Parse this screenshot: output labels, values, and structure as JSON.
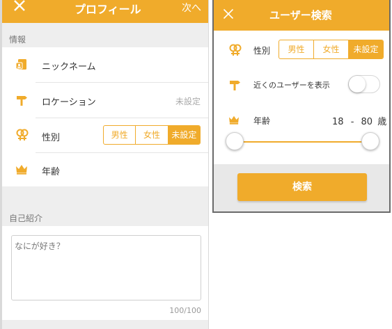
{
  "colors": {
    "accent": "#f0ab2b",
    "background": "#eeeeee",
    "text": "#333333",
    "muted": "#aaaaaa"
  },
  "profile": {
    "header": {
      "title": "プロフィール",
      "close_icon": "close-icon",
      "next_label": "次へ"
    },
    "info_section_label": "情報",
    "rows": {
      "nickname": {
        "label": "ニックネーム",
        "icon": "id-card-icon"
      },
      "location": {
        "label": "ロケーション",
        "value": "未設定",
        "icon": "signpost-icon"
      },
      "gender": {
        "label": "性別",
        "icon": "gender-icon",
        "options": [
          "男性",
          "女性",
          "未設定"
        ],
        "selected": "未設定"
      },
      "age": {
        "label": "年齢",
        "icon": "crown-icon"
      }
    },
    "bio_section_label": "自己紹介",
    "bio": {
      "placeholder": "なにが好き？",
      "counter": "100/100"
    }
  },
  "user_search": {
    "header": {
      "title": "ユーザー検索",
      "close_icon": "close-icon"
    },
    "gender": {
      "label": "性別",
      "options": [
        "男性",
        "女性",
        "未設定"
      ],
      "selected": "未設定"
    },
    "nearby": {
      "label": "近くのユーザーを表示",
      "enabled": false
    },
    "age": {
      "label": "年齢",
      "min": "18",
      "separator": "-",
      "max": "80",
      "unit": "歳"
    },
    "search_button": "検索"
  }
}
